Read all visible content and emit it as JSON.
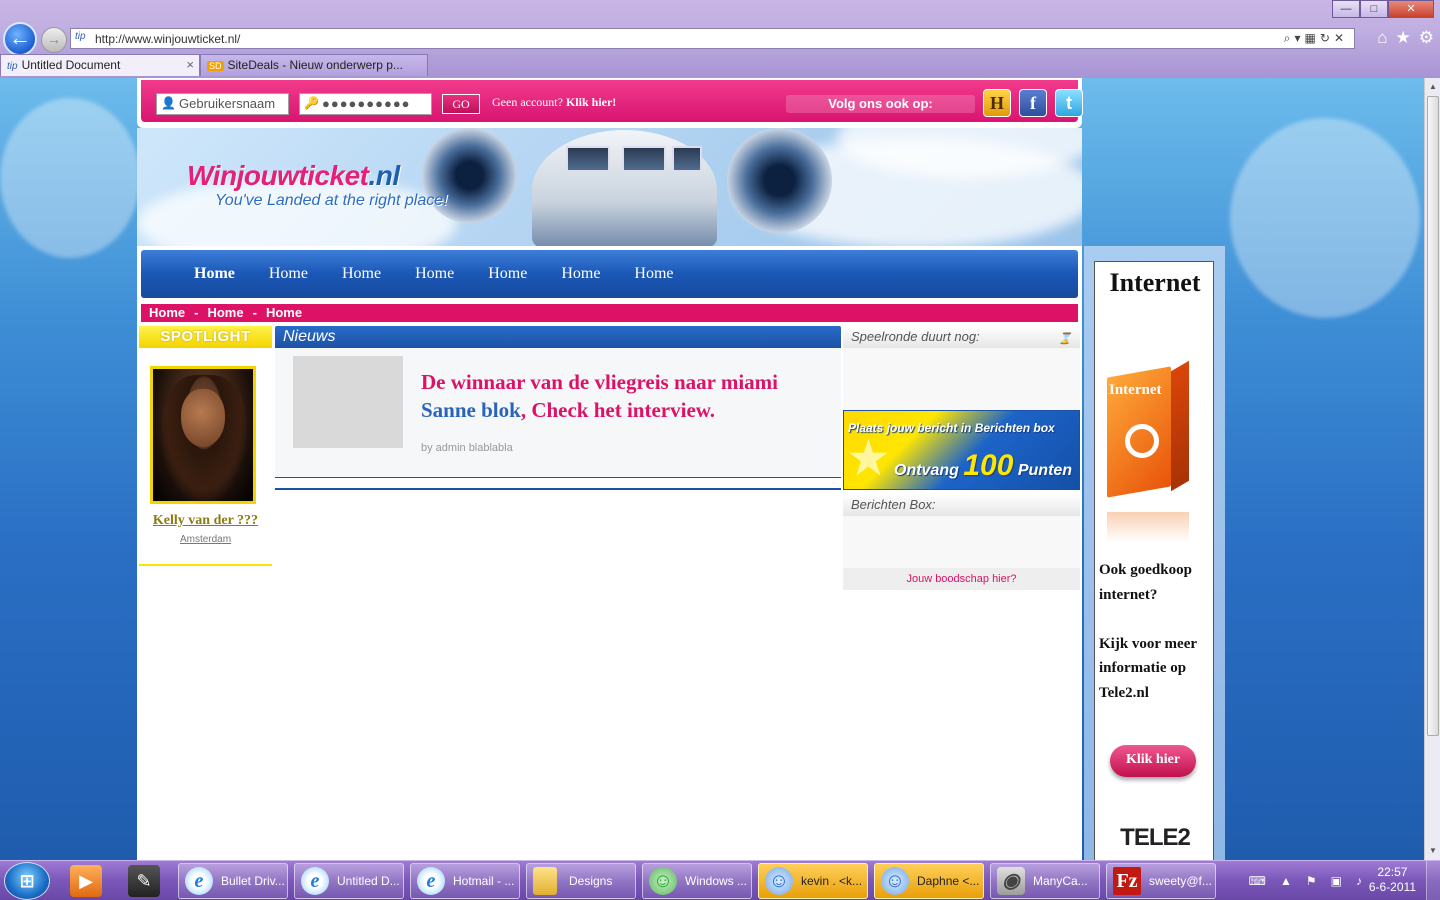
{
  "browser": {
    "url": "http://www.winjouwticket.nl/",
    "tab_favicon": "tip",
    "tabs": [
      {
        "label": "Untitled Document",
        "active": true
      },
      {
        "label": "SiteDeals - Nieuw onderwerp p...",
        "active": false
      }
    ],
    "window_buttons": {
      "minimize": "—",
      "maximize": "□",
      "close": "✕"
    },
    "icons": [
      "back-arrow-icon",
      "forward-arrow-icon",
      "search-icon",
      "refresh-icon",
      "stop-icon",
      "home-icon",
      "favorites-star-icon",
      "gear-icon"
    ]
  },
  "login": {
    "username_placeholder": "Gebruikersnaam",
    "password_value": "●●●●●●●●●●",
    "go_label": "GO",
    "no_account_text": "Geen account?",
    "no_account_link": "Klik hier!",
    "follow_text": "Volg ons ook op:",
    "social": {
      "hyves": "H",
      "facebook": "f",
      "twitter": "t"
    }
  },
  "header": {
    "logo_main": "Winjouwticket",
    "logo_tld": ".nl",
    "tagline": "You've Landed at the right place!"
  },
  "nav": {
    "items": [
      "Home",
      "Home",
      "Home",
      "Home",
      "Home",
      "Home",
      "Home"
    ]
  },
  "breadcrumb": {
    "items": [
      "Home",
      "Home",
      "Home"
    ],
    "separator": "-"
  },
  "spotlight": {
    "heading": "SPOTLIGHT",
    "name": "Kelly van der ???",
    "city": "Amsterdam"
  },
  "news": {
    "heading": "Nieuws",
    "title_part1": "De winnaar van de vliegreis naar miami ",
    "title_winner": "Sanne blok",
    "title_part2": ", Check het interview.",
    "meta": "by admin blablabla"
  },
  "sidebar": {
    "round_heading": "Speelronde duurt nog:",
    "promo_line1": "Plaats jouw bericht in Berichten box",
    "promo_receive": "Ontvang",
    "promo_number": "100",
    "promo_points": "Punten",
    "messages_heading": "Berichten Box:",
    "messages_link": "Jouw boodschap hier?"
  },
  "ad": {
    "title": "Internet",
    "box_label": "Internet",
    "box_brand": "TELE2",
    "text_lines": [
      "Ook goedkoop",
      "internet?",
      "",
      "Kijk voor meer",
      "informatie op",
      "Tele2.nl"
    ],
    "button": "Klik hier",
    "brand": "TELE2"
  },
  "taskbar": {
    "items": [
      {
        "label": "Bullet Driv...",
        "icon": "ie-icon"
      },
      {
        "label": "Untitled D...",
        "icon": "ie-icon"
      },
      {
        "label": "Hotmail - ...",
        "icon": "ie-icon"
      },
      {
        "label": "Designs",
        "icon": "folder-icon"
      },
      {
        "label": "Windows ...",
        "icon": "msn-icon"
      },
      {
        "label": "kevin . <k...",
        "icon": "person-icon",
        "highlight": true
      },
      {
        "label": "Daphne <...",
        "icon": "person-icon",
        "highlight": true
      },
      {
        "label": "ManyCa...",
        "icon": "manycam-icon"
      },
      {
        "label": "sweety@f...",
        "icon": "filezilla-icon"
      }
    ],
    "clock_time": "22:57",
    "clock_date": "6-6-2011"
  }
}
